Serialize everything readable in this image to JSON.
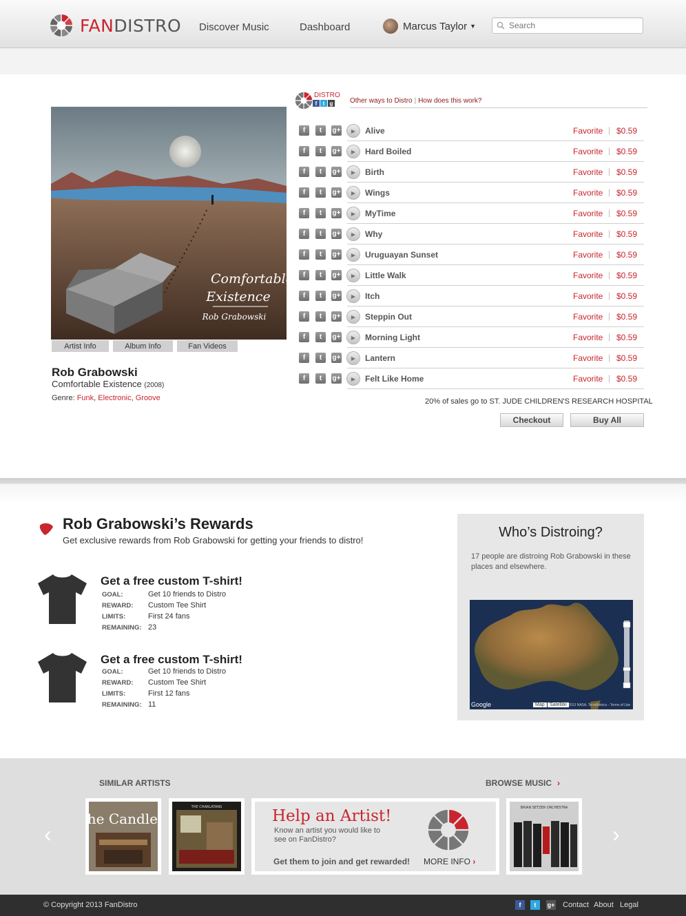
{
  "header": {
    "brand_fan": "FAN",
    "brand_distro": "DISTRO",
    "nav": [
      "Discover Music",
      "Dashboard"
    ],
    "user_name": "Marcus Taylor",
    "search_placeholder": "Search"
  },
  "album": {
    "cover_title_line1": "Comfortable",
    "cover_title_line2": "Existence",
    "cover_artist": "Rob Grabowski",
    "tabs": [
      "Artist Info",
      "Album Info",
      "Fan Videos"
    ],
    "artist": "Rob Grabowski",
    "name": "Comfortable Existence",
    "year": "(2008)",
    "genre_label": "Genre:",
    "genres": [
      "Funk",
      "Electronic",
      "Groove"
    ]
  },
  "distro": {
    "label": "DISTRO",
    "link_other": "Other ways to Distro",
    "link_how": "How does this work?"
  },
  "tracks": [
    {
      "title": "Alive",
      "favorite": "Favorite",
      "price": "$0.59"
    },
    {
      "title": "Hard Boiled",
      "favorite": "Favorite",
      "price": "$0.59"
    },
    {
      "title": "Birth",
      "favorite": "Favorite",
      "price": "$0.59"
    },
    {
      "title": "Wings",
      "favorite": "Favorite",
      "price": "$0.59"
    },
    {
      "title": "MyTime",
      "favorite": "Favorite",
      "price": "$0.59"
    },
    {
      "title": "Why",
      "favorite": "Favorite",
      "price": "$0.59"
    },
    {
      "title": "Uruguayan Sunset",
      "favorite": "Favorite",
      "price": "$0.59"
    },
    {
      "title": "Little Walk",
      "favorite": "Favorite",
      "price": "$0.59"
    },
    {
      "title": "Itch",
      "favorite": "Favorite",
      "price": "$0.59"
    },
    {
      "title": "Steppin Out",
      "favorite": "Favorite",
      "price": "$0.59"
    },
    {
      "title": "Morning Light",
      "favorite": "Favorite",
      "price": "$0.59"
    },
    {
      "title": "Lantern",
      "favorite": "Favorite",
      "price": "$0.59"
    },
    {
      "title": "Felt Like Home",
      "favorite": "Favorite",
      "price": "$0.59"
    }
  ],
  "charity": "20% of sales go to ST. JUDE CHILDREN'S RESEARCH HOSPITAL",
  "buttons": {
    "checkout": "Checkout",
    "buy_all": "Buy All"
  },
  "rewards": {
    "title": "Rob Grabowski’s Rewards",
    "subtitle": "Get exclusive rewards from Rob Grabowski for getting your friends to distro!",
    "items": [
      {
        "heading": "Get a free custom T-shirt!",
        "goal_k": "GOAL:",
        "goal": "Get 10 friends to Distro",
        "reward_k": "REWARD:",
        "reward": "Custom Tee Shirt",
        "limits_k": "LIMITS:",
        "limits": "First 24 fans",
        "remaining_k": "REMAINING:",
        "remaining": "23"
      },
      {
        "heading": "Get a free custom T-shirt!",
        "goal_k": "GOAL:",
        "goal": "Get 10 friends to Distro",
        "reward_k": "REWARD:",
        "reward": "Custom Tee Shirt",
        "limits_k": "LIMITS:",
        "limits": "First 12 fans",
        "remaining_k": "REMAINING:",
        "remaining": "11"
      }
    ]
  },
  "who": {
    "title": "Who’s Distroing?",
    "text": "17 people are distroing Rob Grabowski in these places and elsewhere.",
    "map_google": "Google",
    "map_tab1": "Map",
    "map_tab2": "Satellite",
    "map_credit": "© 2013 NASA, TerraMetrics - Terms of Use"
  },
  "similar": {
    "label": "SIMILAR ARTISTS",
    "browse": "BROWSE MUSIC",
    "browse_arrow": "›",
    "card1_text": "the Candles",
    "card2_text": "THE CHARLATANS",
    "card3_text": "BRIAN SETZER ORCHESTRA"
  },
  "help": {
    "title": "Help an Artist!",
    "desc": "Know an artist you would like to see on FanDistro?",
    "cta": "Get them to join and get rewarded!",
    "more": "MORE INFO",
    "more_arrow": "›"
  },
  "footer": {
    "copyright": "© Copyright 2013 FanDistro",
    "links": [
      "Contact",
      "About",
      "Legal"
    ]
  },
  "colors": {
    "accent": "#c9252e",
    "dark": "#2f2f2f"
  }
}
